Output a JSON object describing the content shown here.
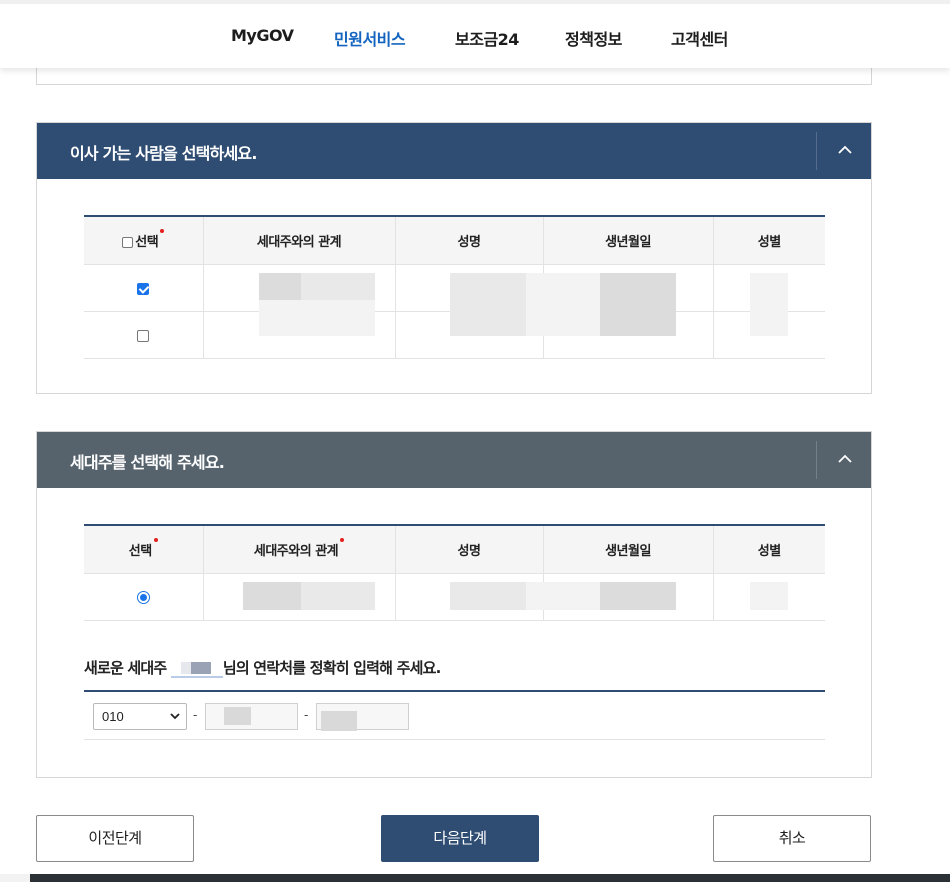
{
  "nav": {
    "items": [
      {
        "label": "MyGOV",
        "active": false
      },
      {
        "label": "민원서비스",
        "active": true
      },
      {
        "label": "보조금24",
        "active": false
      },
      {
        "label": "정책정보",
        "active": false
      },
      {
        "label": "고객센터",
        "active": false
      }
    ]
  },
  "section_movers": {
    "title": "이사 가는 사람을 선택하세요.",
    "header_color": "#2f4d73",
    "columns": [
      "선택",
      "세대주와의 관계",
      "성명",
      "생년월일",
      "성별"
    ],
    "rows": [
      {
        "selected": true
      },
      {
        "selected": false
      }
    ]
  },
  "section_head": {
    "title": "세대주를 선택해 주세요.",
    "header_color": "#56636d",
    "columns": [
      "선택",
      "세대주와의 관계",
      "성명",
      "생년월일",
      "성별"
    ],
    "rows": [
      {
        "selected": true
      }
    ],
    "contact_prompt_prefix": "새로운 세대주",
    "contact_prompt_suffix": "님의 연락처를 정확히 입력해 주세요.",
    "phone_prefix": "010",
    "separator": "-"
  },
  "buttons": {
    "prev": "이전단계",
    "next": "다음단계",
    "cancel": "취소"
  }
}
